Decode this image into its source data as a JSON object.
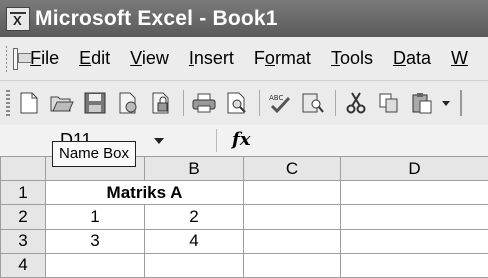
{
  "window": {
    "title": "Microsoft Excel - Book1"
  },
  "menu": [
    {
      "label": "File",
      "underline": "F",
      "rest": "ile"
    },
    {
      "label": "Edit",
      "underline": "E",
      "rest": "dit"
    },
    {
      "label": "View",
      "underline": "V",
      "rest": "iew"
    },
    {
      "label": "Insert",
      "underline": "I",
      "rest": "nsert"
    },
    {
      "label": "Format",
      "pre": "F",
      "underline": "o",
      "rest": "rmat"
    },
    {
      "label": "Tools",
      "underline": "T",
      "rest": "ools"
    },
    {
      "label": "Data",
      "underline": "D",
      "rest": "ata"
    },
    {
      "label": "Window",
      "underline": "W",
      "rest": ""
    }
  ],
  "toolbar": {
    "icons": [
      "new-icon",
      "open-icon",
      "save-icon",
      "permission-icon",
      "print-icon",
      "print-preview-icon",
      "spelling-icon",
      "research-icon",
      "cut-icon",
      "copy-icon",
      "paste-icon"
    ]
  },
  "formula_bar": {
    "name_box_value": "D11",
    "fx_label": "fx",
    "tooltip": "Name Box"
  },
  "sheet": {
    "columns": [
      "B",
      "C",
      "D"
    ],
    "rows": [
      {
        "header": "1",
        "cells": [
          "Matriks A"
        ]
      },
      {
        "header": "2",
        "cells": [
          "1",
          "2",
          "",
          ""
        ]
      },
      {
        "header": "3",
        "cells": [
          "3",
          "4",
          "",
          ""
        ]
      },
      {
        "header": "4",
        "cells": [
          "",
          "",
          "",
          ""
        ]
      }
    ]
  }
}
